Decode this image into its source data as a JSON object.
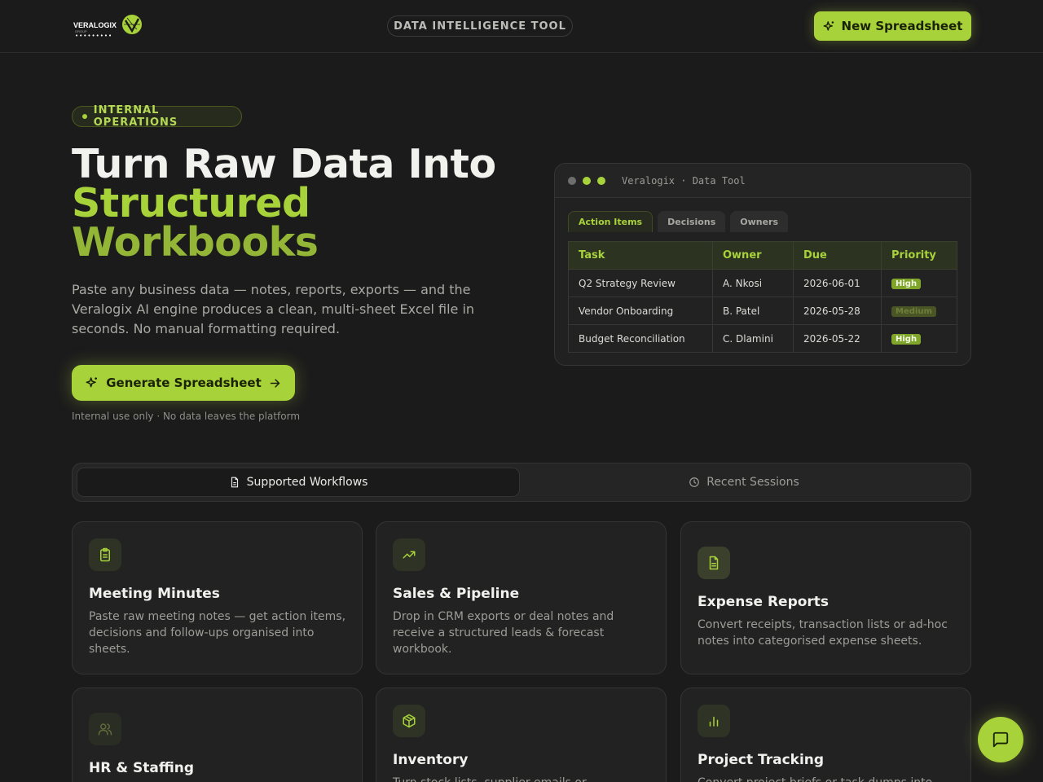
{
  "header": {
    "logo": {
      "word_a": "VERA",
      "word_b": "LOGIX",
      "sub": "GROUP",
      "dots": "•••••••••"
    },
    "center_pill": "DATA INTELLIGENCE TOOL",
    "new_button": "New Spreadsheet"
  },
  "hero": {
    "badge": "INTERNAL OPERATIONS",
    "title_line1": "Turn Raw Data Into",
    "title_line2": "Structured",
    "title_line3": "Workbooks",
    "description": "Paste any business data — notes, reports, exports — and the Veralogix AI engine produces a clean, multi-sheet Excel file in seconds. No manual formatting required.",
    "cta": "Generate Spreadsheet",
    "note": "Internal use only · No data leaves the platform"
  },
  "preview": {
    "title": "Veralogix · Data Tool",
    "dot_colors": [
      "#6e6e6e",
      "#a8d23a",
      "#a8d23a"
    ],
    "tabs": [
      "Action Items",
      "Decisions",
      "Owners"
    ],
    "columns": [
      "Task",
      "Owner",
      "Due",
      "Priority"
    ],
    "rows": [
      {
        "task": "Q2 Strategy Review",
        "owner": "A. Nkosi",
        "due": "2026-06-01",
        "priority": "High"
      },
      {
        "task": "Vendor Onboarding",
        "owner": "B. Patel",
        "due": "2026-05-28",
        "priority": "Medium"
      },
      {
        "task": "Budget Reconciliation",
        "owner": "C. Dlamini",
        "due": "2026-05-22",
        "priority": "High"
      }
    ]
  },
  "segmented": {
    "active": "Supported Workflows",
    "inactive": "Recent Sessions"
  },
  "cards": [
    {
      "icon": "clipboard-icon",
      "title": "Meeting Minutes",
      "description": "Paste raw meeting notes — get action items, decisions and follow-ups organised into sheets."
    },
    {
      "icon": "trending-up-icon",
      "title": "Sales & Pipeline",
      "description": "Drop in CRM exports or deal notes and receive a structured leads & forecast workbook."
    },
    {
      "icon": "file-text-icon",
      "title": "Expense Reports",
      "description": "Convert receipts, transaction lists or ad-hoc notes into categorised expense sheets."
    },
    {
      "icon": "users-icon",
      "title": "HR & Staffing",
      "description": ""
    },
    {
      "icon": "package-icon",
      "title": "Inventory",
      "description": "Turn stock lists, supplier emails or"
    },
    {
      "icon": "bar-chart-icon",
      "title": "Project Tracking",
      "description": "Convert project briefs or task dumps into"
    }
  ],
  "colors": {
    "accent": "#a8d23a",
    "background": "#1c1b1c",
    "card": "#232223"
  }
}
